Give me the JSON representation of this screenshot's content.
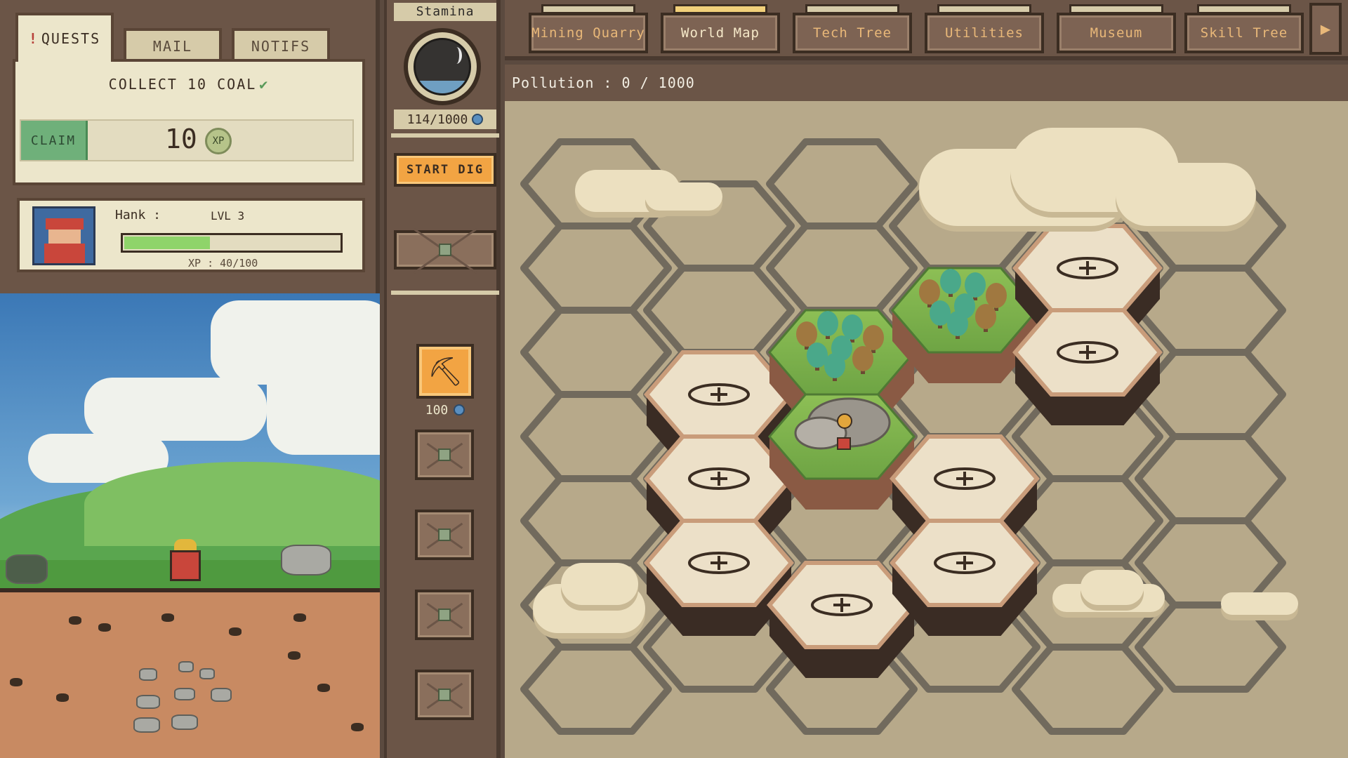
{
  "quests_panel": {
    "tabs": {
      "quests": "QUESTS",
      "mail": "MAIL",
      "notifs": "NOTIFS"
    },
    "quest": {
      "title": "COLLECT 10 COAL",
      "claim_label": "CLAIM",
      "reward_amount": "10",
      "reward_unit": "XP"
    }
  },
  "player": {
    "name": "Hank :",
    "level": "LVL 3",
    "xp_text": "XP : 40/100",
    "xp_fraction": 0.4
  },
  "stamina": {
    "label": "Stamina",
    "count": "114/1000",
    "fraction": 0.114
  },
  "actions": {
    "start_dig": "START DIG",
    "tool_cost": "100"
  },
  "nav": {
    "mining_quarry": "Mining Quarry",
    "world_map": "World Map",
    "tech_tree": "Tech Tree",
    "utilities": "Utilities",
    "museum": "Museum",
    "skill_tree": "Skill Tree"
  },
  "map": {
    "pollution": "Pollution : 0 / 1000"
  },
  "colors": {
    "panel": "#6b5547",
    "parchment": "#ece6cb",
    "accent_orange": "#f2a443",
    "claim_green": "#6fb07a",
    "map_bg": "#b7a98a"
  },
  "icons": {
    "quest_alert": "exclamation-icon",
    "complete": "check-icon",
    "currency": "gem-icon",
    "tool": "pickaxe-icon",
    "expand": "plus-icon",
    "next": "arrow-right-icon"
  }
}
